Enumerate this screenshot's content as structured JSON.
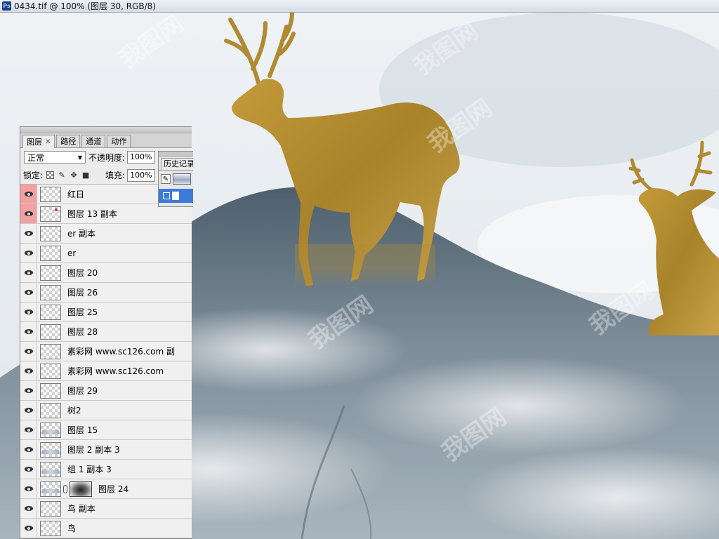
{
  "window": {
    "title": "0434.tif @ 100% (图层 30, RGB/8)",
    "app_icon": "photoshop-icon"
  },
  "layers_panel": {
    "tabs": [
      {
        "label": "图层",
        "active": true,
        "closable": true
      },
      {
        "label": "路径",
        "active": false
      },
      {
        "label": "通道",
        "active": false
      },
      {
        "label": "动作",
        "active": false
      }
    ],
    "blend_mode": "正常",
    "opacity_label": "不透明度:",
    "opacity_value": "100%",
    "lock_label": "锁定:",
    "fill_label": "填充:",
    "fill_value": "100%",
    "layers": [
      {
        "name": "红日",
        "visible": true,
        "selected": true
      },
      {
        "name": "图层 13 副本",
        "visible": true,
        "selected": true
      },
      {
        "name": "er 副本",
        "visible": true
      },
      {
        "name": "er",
        "visible": true
      },
      {
        "name": "图层 20",
        "visible": true
      },
      {
        "name": "图层 26",
        "visible": true
      },
      {
        "name": "图层 25",
        "visible": true
      },
      {
        "name": "图层 28",
        "visible": true
      },
      {
        "name": "素彩网 www.sc126.com 副",
        "visible": true
      },
      {
        "name": "素彩网 www.sc126.com",
        "visible": true
      },
      {
        "name": "图层 29",
        "visible": true
      },
      {
        "name": "树2",
        "visible": true
      },
      {
        "name": "图层 15",
        "visible": true
      },
      {
        "name": "图层 2 副本 3",
        "visible": true
      },
      {
        "name": "组 1 副本 3",
        "visible": true
      },
      {
        "name": "图层 24",
        "visible": true,
        "has_mask": true
      },
      {
        "name": "鸟 副本",
        "visible": true
      },
      {
        "name": "鸟",
        "visible": true
      }
    ]
  },
  "history_panel": {
    "tab_label": "历史记录"
  },
  "colors": {
    "deer_gold": "#b8902f",
    "mountain_ink": "#5c6e7c",
    "sky": "#e9eef2",
    "selected_eye_bg": "#f4a0a0"
  },
  "watermark": "我图网"
}
